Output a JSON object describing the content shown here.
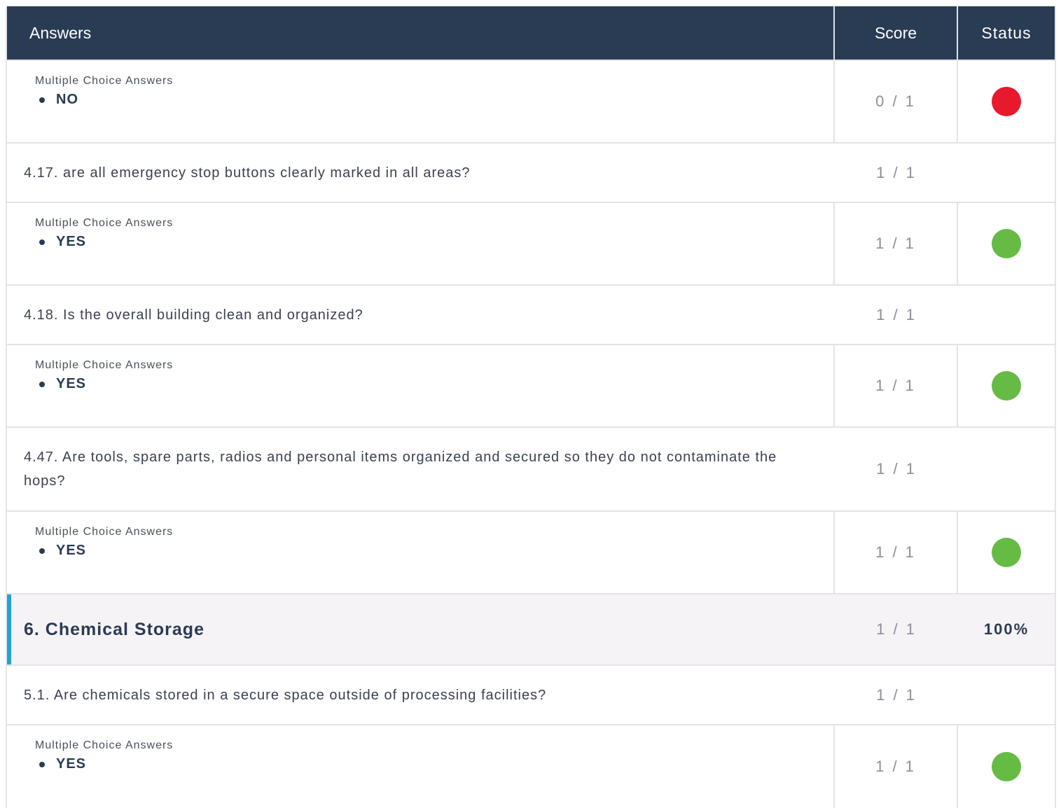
{
  "header": {
    "answers": "Answers",
    "score": "Score",
    "status": "Status"
  },
  "rows": [
    {
      "kind": "answer",
      "label": "Multiple Choice Answers",
      "value": "NO",
      "score": "0 / 1",
      "status": "fail",
      "status_color": "#e8192c"
    },
    {
      "kind": "question",
      "text": "4.17. are all emergency stop buttons clearly marked in all areas?",
      "score": "1 / 1"
    },
    {
      "kind": "answer",
      "label": "Multiple Choice Answers",
      "value": "YES",
      "score": "1 / 1",
      "status": "pass",
      "status_color": "#66bb44"
    },
    {
      "kind": "question",
      "text": "4.18. Is the overall building clean and organized?",
      "score": "1 / 1"
    },
    {
      "kind": "answer",
      "label": "Multiple Choice Answers",
      "value": "YES",
      "score": "1 / 1",
      "status": "pass",
      "status_color": "#66bb44"
    },
    {
      "kind": "question",
      "text": "4.47. Are tools, spare parts, radios and personal items organized and secured so they do not contaminate the hops?",
      "score": "1 / 1"
    },
    {
      "kind": "answer",
      "label": "Multiple Choice Answers",
      "value": "YES",
      "score": "1 / 1",
      "status": "pass",
      "status_color": "#66bb44"
    },
    {
      "kind": "section",
      "title": "6. Chemical Storage",
      "score": "1 / 1",
      "percent": "100%",
      "accent_color": "#1ea3d8"
    },
    {
      "kind": "question",
      "text": "5.1. Are chemicals stored in a secure space outside of processing facilities?",
      "score": "1 / 1"
    },
    {
      "kind": "answer",
      "label": "Multiple Choice Answers",
      "value": "YES",
      "score": "1 / 1",
      "status": "pass",
      "status_color": "#66bb44"
    }
  ]
}
